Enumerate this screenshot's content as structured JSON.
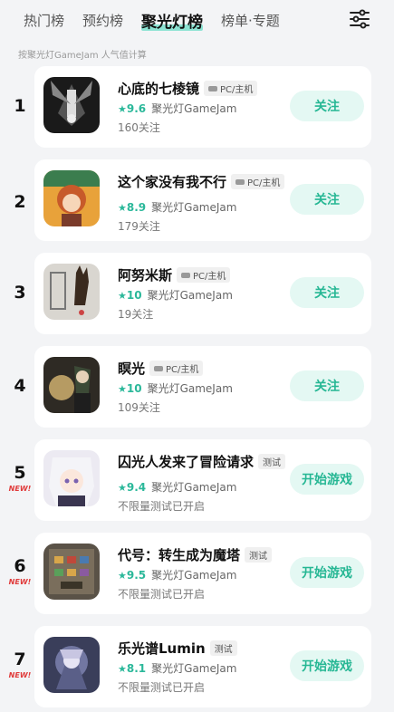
{
  "tabs": [
    "热门榜",
    "预约榜",
    "聚光灯榜",
    "榜单·专题"
  ],
  "active_tab": 2,
  "subtitle": "按聚光灯GameJam 人气值计算",
  "icons": {
    "filter": "filter-sliders-icon",
    "platform": "gamepad-icon",
    "star": "star-icon"
  },
  "colors": {
    "accent": "#26b794",
    "button_bg": "#e4f8f3",
    "new": "#e03a3a"
  },
  "items": [
    {
      "rank": "1",
      "new": "",
      "title": "心底的七棱镜",
      "tag": "PC/主机",
      "score": "9.6",
      "source": "聚光灯GameJam",
      "sub": "160关注",
      "button": "关注"
    },
    {
      "rank": "2",
      "new": "",
      "title": "这个家没有我不行",
      "tag": "PC/主机",
      "score": "8.9",
      "source": "聚光灯GameJam",
      "sub": "179关注",
      "button": "关注"
    },
    {
      "rank": "3",
      "new": "",
      "title": "阿努米斯",
      "tag": "PC/主机",
      "score": "10",
      "source": "聚光灯GameJam",
      "sub": "19关注",
      "button": "关注"
    },
    {
      "rank": "4",
      "new": "",
      "title": "瞑光",
      "tag": "PC/主机",
      "score": "10",
      "source": "聚光灯GameJam",
      "sub": "109关注",
      "button": "关注"
    },
    {
      "rank": "5",
      "new": "NEW!",
      "title": "囚光人发来了冒险请求",
      "tag": "测试",
      "score": "9.4",
      "source": "聚光灯GameJam",
      "sub": "不限量测试已开启",
      "button": "开始游戏"
    },
    {
      "rank": "6",
      "new": "NEW!",
      "title": "代号：转生成为魔塔",
      "tag": "测试",
      "score": "9.5",
      "source": "聚光灯GameJam",
      "sub": "不限量测试已开启",
      "button": "开始游戏"
    },
    {
      "rank": "7",
      "new": "NEW!",
      "title": "乐光谱Lumin",
      "tag": "测试",
      "score": "8.1",
      "source": "聚光灯GameJam",
      "sub": "不限量测试已开启",
      "button": "开始游戏"
    }
  ]
}
